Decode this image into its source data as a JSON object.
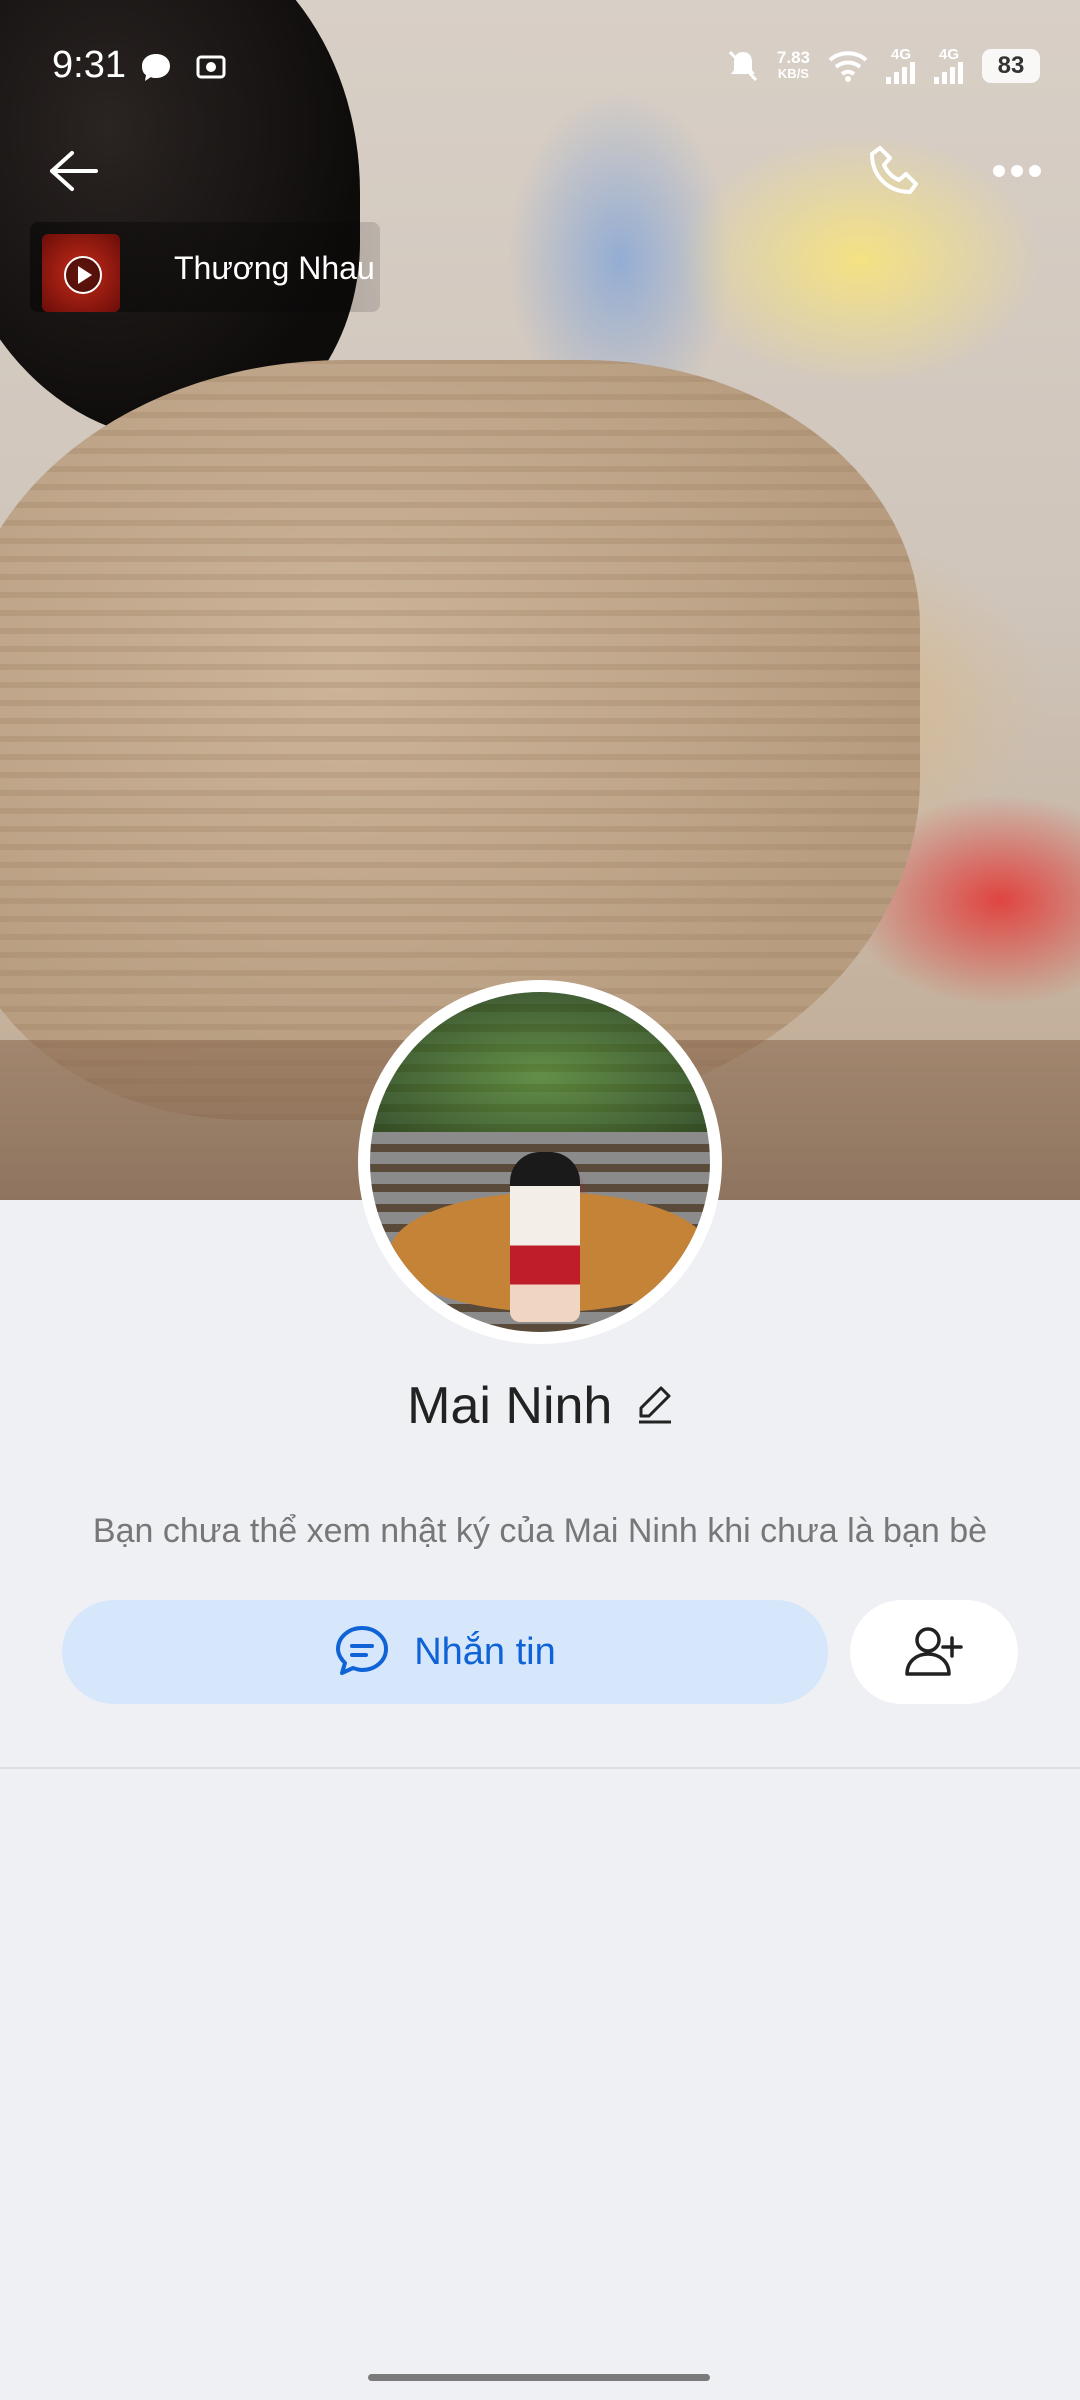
{
  "status_bar": {
    "time": "9:31",
    "net_speed_value": "7.83",
    "net_speed_unit": "KB/S",
    "signal1": "4G",
    "signal2": "4G",
    "battery": "83"
  },
  "music": {
    "title": "Thương Nhau"
  },
  "profile": {
    "name": "Mai Ninh",
    "privacy_note": "Bạn chưa thể xem nhật ký của Mai Ninh khi chưa là bạn bè"
  },
  "actions": {
    "message_label": "Nhắn tin"
  },
  "colors": {
    "accent": "#0f63d6",
    "button_bg": "#d6e6fb",
    "page_bg": "#eff0f4"
  }
}
